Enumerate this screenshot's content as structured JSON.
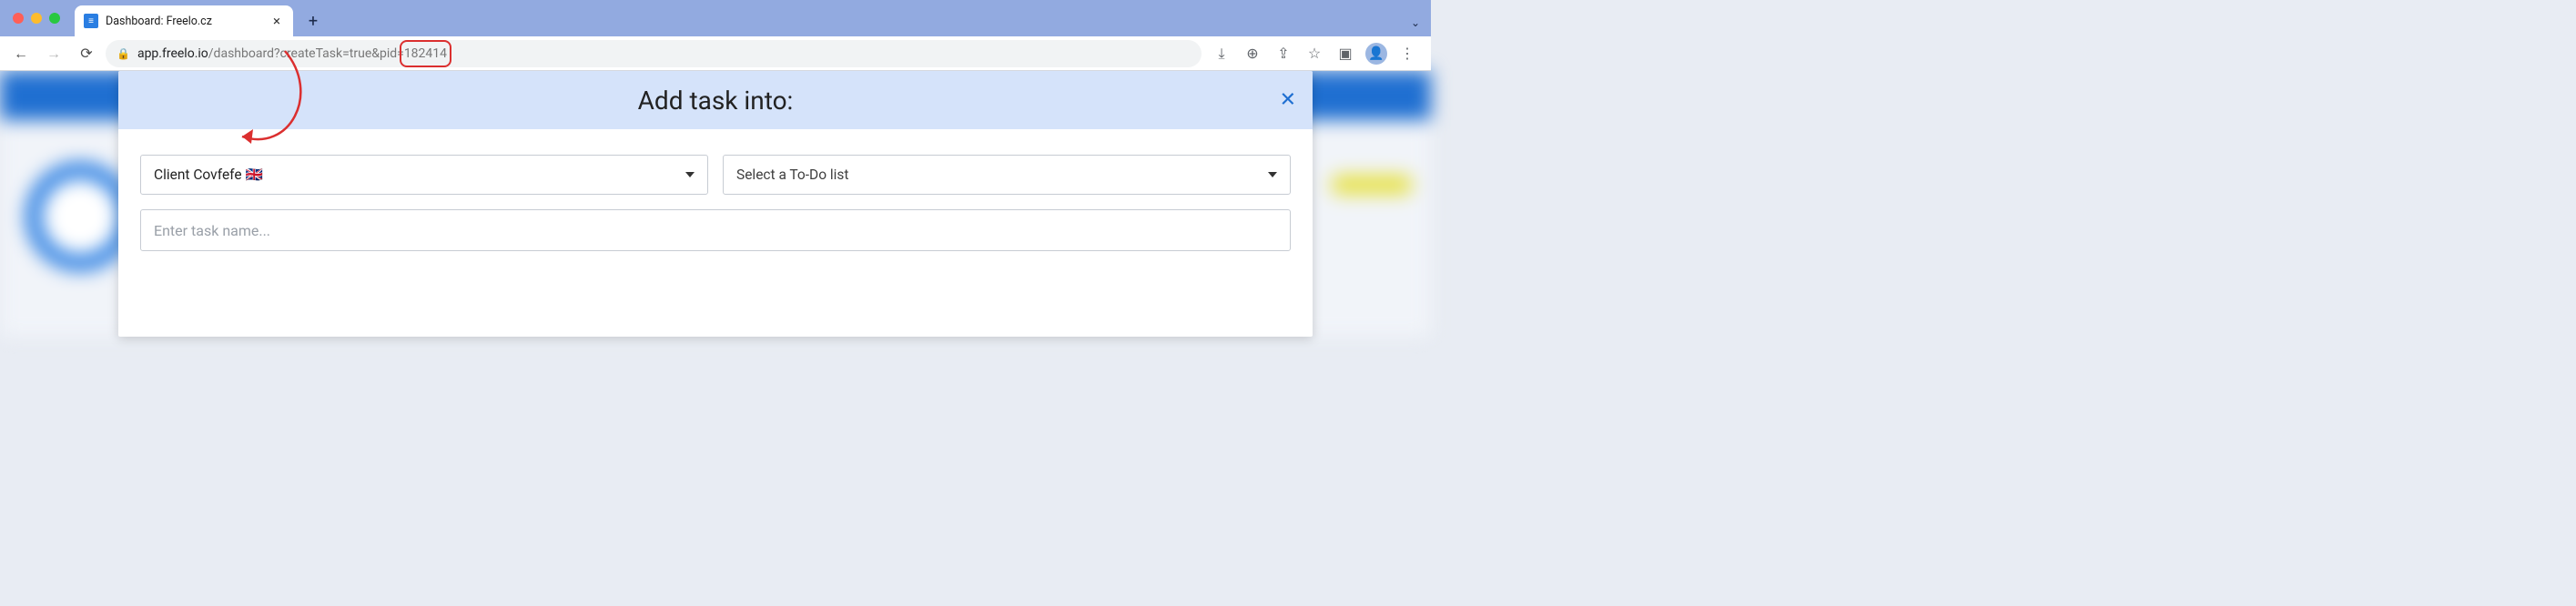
{
  "browser": {
    "tab": {
      "title": "Dashboard: Freelo.cz",
      "favicon_glyph": "≡"
    },
    "url": {
      "domain": "app.freelo.io",
      "path_prefix": "/dashboard?createTask=true&pid=",
      "pid": "182414"
    }
  },
  "modal": {
    "title": "Add task into:",
    "close_label": "✕",
    "client_select": {
      "value": "Client Covfefe 🇬🇧"
    },
    "todo_select": {
      "placeholder": "Select a To-Do list"
    },
    "task_input": {
      "placeholder": "Enter task name..."
    }
  },
  "icons": {
    "chevron_down": "⌄",
    "plus": "+",
    "back": "←",
    "forward": "→",
    "reload": "⟳",
    "lock": "🔒",
    "download": "⤓",
    "zoom": "⊕",
    "share": "⇪",
    "star": "☆",
    "panel": "▣",
    "profile": "👤",
    "kebab": "⋮"
  }
}
